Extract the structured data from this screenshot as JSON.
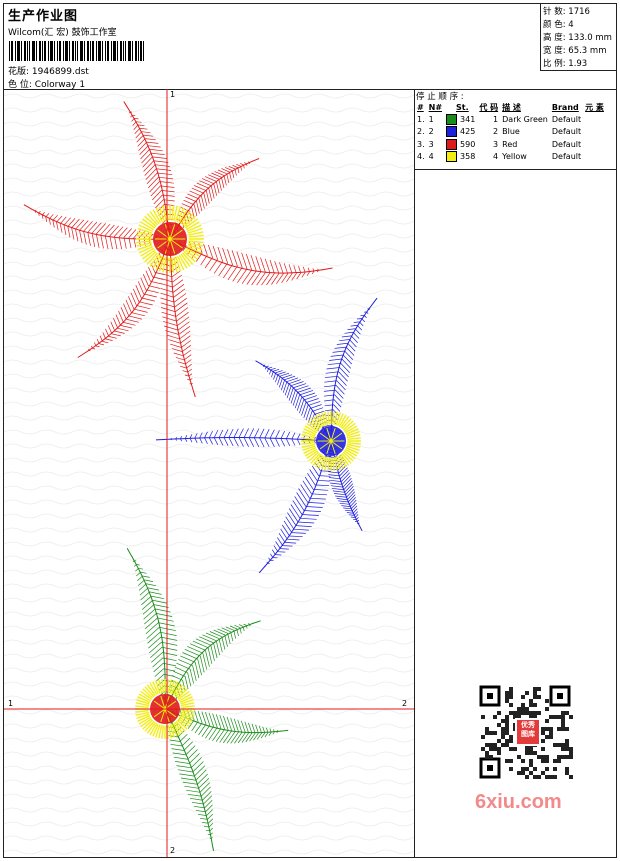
{
  "header": {
    "title": "生产作业图",
    "company": "Wilcom(汇 宏) 鼓饰工作室",
    "design_label": "花版:",
    "design_file": "1946899.dst",
    "colorway_label": "色 位:",
    "colorway": "Colorway 1"
  },
  "specs": {
    "stitches_label": "针 数:",
    "stitches": "1716",
    "colors_label": "颜 色:",
    "colors": "4",
    "height_label": "高 度:",
    "height": "133.0 mm",
    "width_label": "宽 度:",
    "width": "65.3 mm",
    "scale_label": "比 例:",
    "scale": "1.93"
  },
  "stop_sequence": {
    "title": "停 止 顺 序 :",
    "columns": [
      "#",
      "N#",
      "St.",
      "代 码",
      "描 述",
      "Brand",
      "元 素"
    ],
    "rows": [
      {
        "idx": "1.",
        "n": "1",
        "st": "341",
        "code": "1",
        "desc": "Dark Green",
        "brand": "Default",
        "color": "#1a8c1a"
      },
      {
        "idx": "2.",
        "n": "2",
        "st": "425",
        "code": "2",
        "desc": "Blue",
        "brand": "Default",
        "color": "#1f1fe0"
      },
      {
        "idx": "3.",
        "n": "3",
        "st": "590",
        "code": "3",
        "desc": "Red",
        "brand": "Default",
        "color": "#e01a1a"
      },
      {
        "idx": "4.",
        "n": "4",
        "st": "358",
        "code": "4",
        "desc": "Yellow",
        "brand": "Default",
        "color": "#f2ee12"
      }
    ]
  },
  "axes": {
    "vertical_top": "1",
    "vertical_bottom": "2",
    "horizontal_left": "1",
    "horizontal_right": "2",
    "color": "#e01a1a"
  },
  "watermark": {
    "text": "6xiu.com",
    "stamp": "优秀 图库"
  }
}
